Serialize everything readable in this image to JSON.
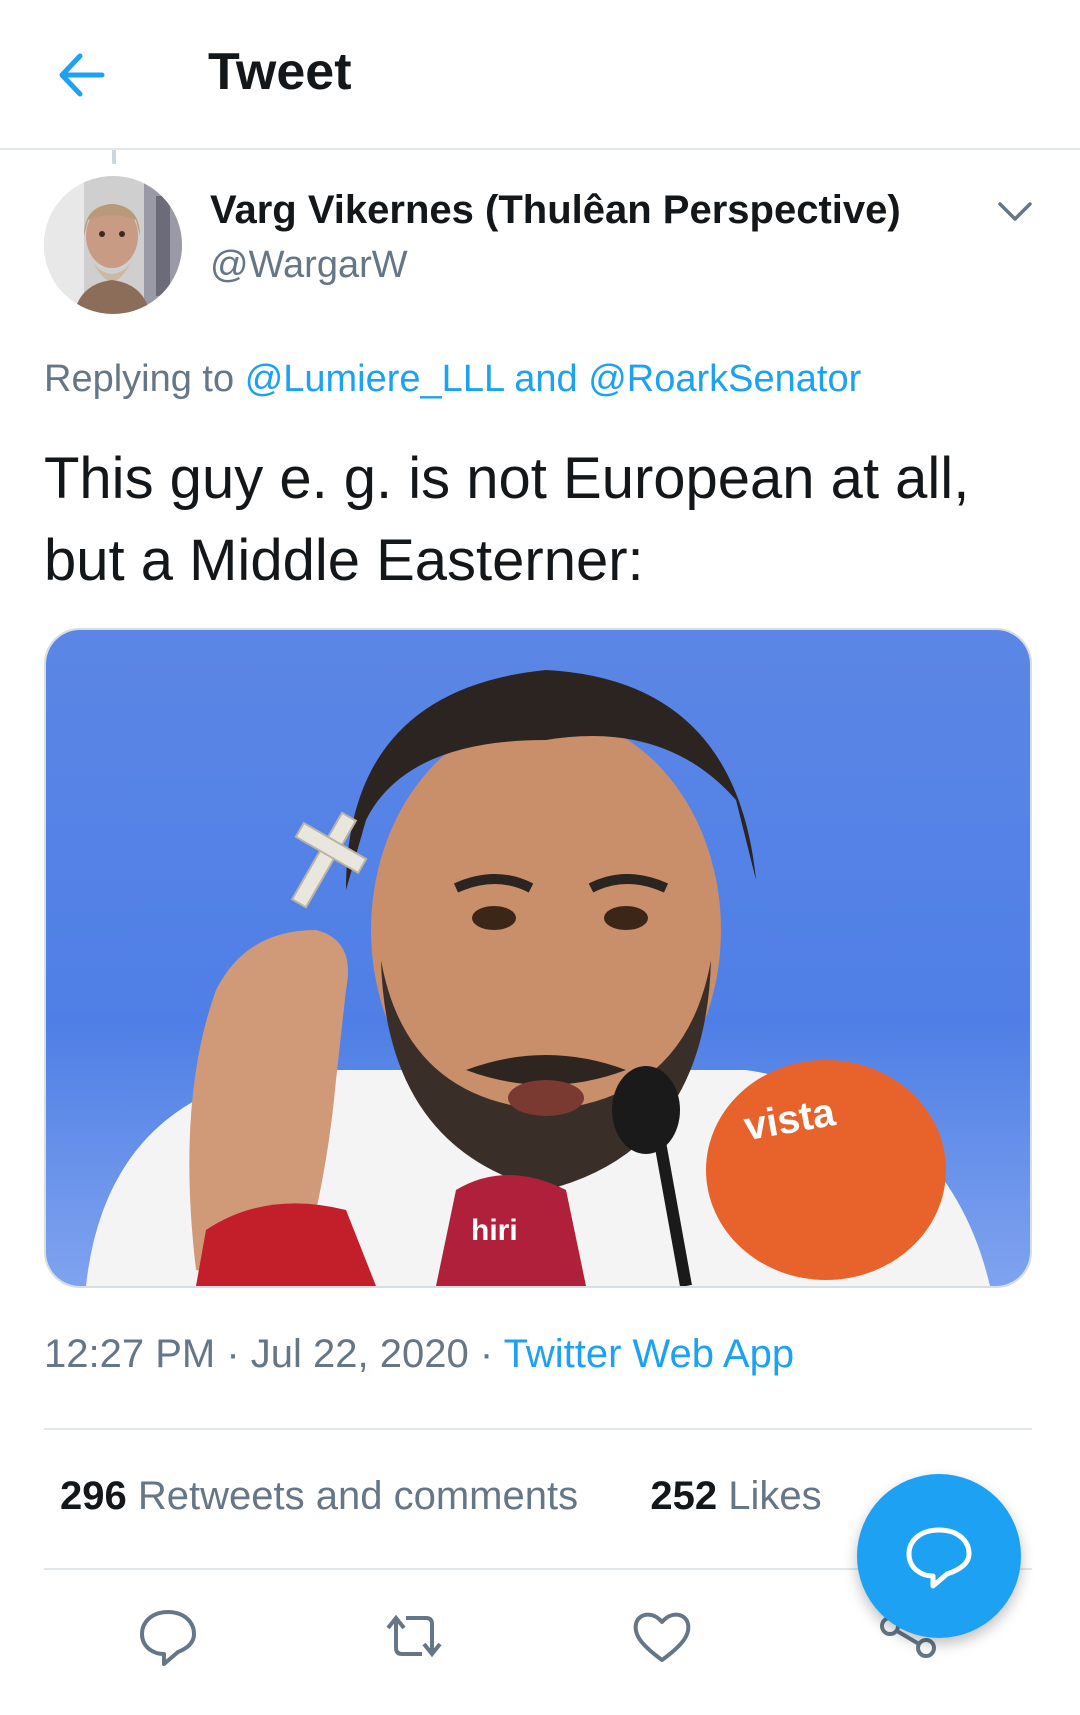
{
  "header": {
    "title": "Tweet",
    "back_icon": "arrow-left-icon"
  },
  "author": {
    "name": "Varg Vikernes (Thulêan Perspective)",
    "handle": "@WargarW"
  },
  "reply": {
    "prefix": "Replying to",
    "user1": "@Lumiere_LLL",
    "and": "and",
    "user2": "@RoarkSenator"
  },
  "tweet": {
    "line1": "This guy e. g. is not European at all,",
    "line2": "but a Middle Easterner:"
  },
  "media": {
    "mic_label_1": "hiri",
    "mic_label_2": "vista"
  },
  "meta": {
    "time": "12:27 PM",
    "sep": "·",
    "date": "Jul 22, 2020",
    "source": "Twitter Web App"
  },
  "stats": {
    "retweets_count": "296",
    "retweets_label": "Retweets and comments",
    "likes_count": "252",
    "likes_label": "Likes"
  },
  "actions": [
    "reply-icon",
    "retweet-icon",
    "like-icon",
    "share-icon"
  ],
  "colors": {
    "accent": "#1da1f2",
    "secondary_text": "#657786",
    "primary_text": "#14171a",
    "divider": "#e1e8ed"
  }
}
